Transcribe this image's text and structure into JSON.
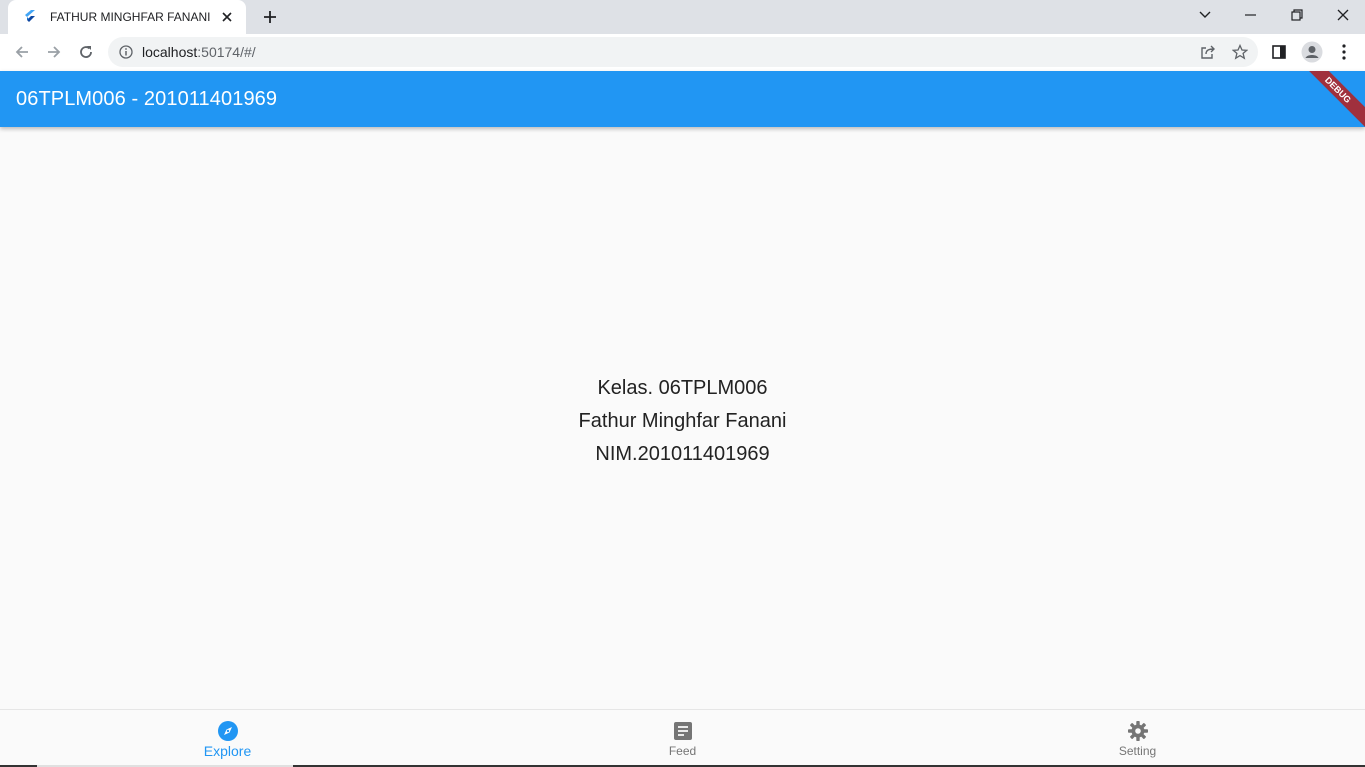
{
  "browser": {
    "tab_title": "FATHUR MINGHFAR FANANI",
    "url_host": "localhost",
    "url_rest": ":50174/#/"
  },
  "app": {
    "title": "06TPLM006 - 201011401969",
    "debug_label": "DEBUG",
    "accent_color": "#2196f3",
    "debug_color": "#a0303d"
  },
  "content": {
    "line1": "Kelas. 06TPLM006",
    "line2": "Fathur Minghfar Fanani",
    "line3": "NIM.201011401969"
  },
  "bottom_nav": {
    "items": [
      {
        "label": "Explore",
        "icon": "explore-icon",
        "active": true
      },
      {
        "label": "Feed",
        "icon": "article-icon",
        "active": false
      },
      {
        "label": "Setting",
        "icon": "gear-icon",
        "active": false
      }
    ]
  }
}
